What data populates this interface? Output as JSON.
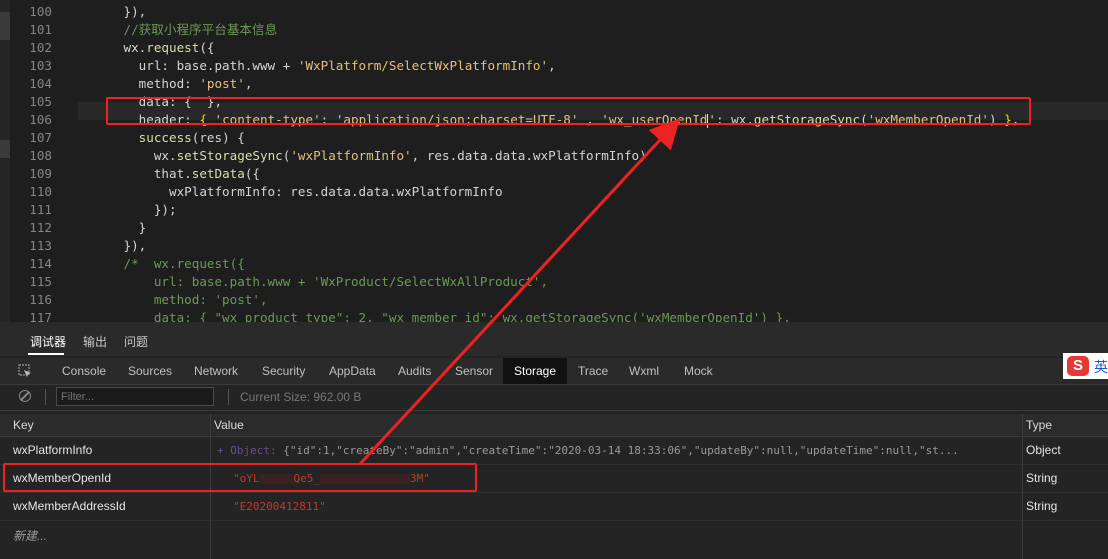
{
  "editor": {
    "lines": [
      {
        "n": "100",
        "parts": [
          [
            "k",
            "      }),"
          ]
        ]
      },
      {
        "n": "101",
        "parts": [
          [
            "c",
            "      //获取小程序平台基本信息"
          ]
        ]
      },
      {
        "n": "102",
        "parts": [
          [
            "k",
            "      wx."
          ],
          [
            "f",
            "request"
          ],
          [
            "k",
            "({"
          ]
        ]
      },
      {
        "n": "103",
        "parts": [
          [
            "k",
            "        url: base.path.www + "
          ],
          [
            "s",
            "'WxPlatform/SelectWxPlatformInfo'"
          ],
          [
            "k",
            ","
          ]
        ]
      },
      {
        "n": "104",
        "parts": [
          [
            "k",
            "        method: "
          ],
          [
            "s",
            "'post'"
          ],
          [
            "k",
            ","
          ]
        ]
      },
      {
        "n": "105",
        "parts": [
          [
            "k",
            "        data: {  },"
          ]
        ]
      },
      {
        "n": "106",
        "parts": [
          [
            "k",
            "        header: "
          ],
          [
            "y",
            "{"
          ],
          [
            "k",
            " "
          ],
          [
            "s",
            "'content-type'"
          ],
          [
            "k",
            ": "
          ],
          [
            "s",
            "'application/json;charset=UTF-8'"
          ],
          [
            "k",
            " , "
          ],
          [
            "s",
            "'wx_userOpenId"
          ],
          [
            "cursor",
            ""
          ],
          [
            "s",
            "'"
          ],
          [
            "k",
            ": wx."
          ],
          [
            "f",
            "getStorageSync"
          ],
          [
            "k",
            "("
          ],
          [
            "s",
            "'wxMemberOpenId'"
          ],
          [
            "k",
            ") "
          ],
          [
            "y",
            "}"
          ],
          [
            "k",
            ","
          ]
        ]
      },
      {
        "n": "107",
        "parts": [
          [
            "k",
            "        "
          ],
          [
            "f",
            "success"
          ],
          [
            "k",
            "(res) {"
          ]
        ]
      },
      {
        "n": "108",
        "parts": [
          [
            "k",
            "          wx."
          ],
          [
            "f",
            "setStorageSync"
          ],
          [
            "k",
            "("
          ],
          [
            "s",
            "'wxPlatformInfo'"
          ],
          [
            "k",
            ", res.data.data.wxPlatformInfo)"
          ]
        ]
      },
      {
        "n": "109",
        "parts": [
          [
            "k",
            "          that."
          ],
          [
            "f",
            "setData"
          ],
          [
            "k",
            "({"
          ]
        ]
      },
      {
        "n": "110",
        "parts": [
          [
            "k",
            "            wxPlatformInfo: res.data.data.wxPlatformInfo"
          ]
        ]
      },
      {
        "n": "111",
        "parts": [
          [
            "k",
            "          });"
          ]
        ]
      },
      {
        "n": "112",
        "parts": [
          [
            "k",
            "        }"
          ]
        ]
      },
      {
        "n": "113",
        "parts": [
          [
            "k",
            "      }),"
          ]
        ]
      },
      {
        "n": "114",
        "parts": [
          [
            "c",
            "      /*  wx.request({"
          ]
        ]
      },
      {
        "n": "115",
        "parts": [
          [
            "c",
            "          url: base.path.www + 'WxProduct/SelectWxAllProduct',"
          ]
        ]
      },
      {
        "n": "116",
        "parts": [
          [
            "c",
            "          method: 'post',"
          ]
        ]
      },
      {
        "n": "117",
        "parts": [
          [
            "c",
            "          data: { \"wx_product_type\": 2, \"wx_member_id\": wx.getStorageSync('wxMemberOpenId') },"
          ]
        ]
      }
    ]
  },
  "devtools": {
    "top_tabs": [
      "调试器",
      "输出",
      "问题"
    ],
    "panel_tabs": [
      "Console",
      "Sources",
      "Network",
      "Security",
      "AppData",
      "Audits",
      "Sensor",
      "Storage",
      "Trace",
      "Wxml",
      "Mock"
    ],
    "active_panel": "Storage",
    "filter_placeholder": "Filter...",
    "current_size": "Current Size: 962.00 B",
    "ime_label": "英",
    "ime_logo": "S",
    "table": {
      "headers": {
        "key": "Key",
        "value": "Value",
        "type": "Type"
      },
      "rows": [
        {
          "key": "wxPlatformInfo",
          "value_prefix": "+ Object:",
          "value": " {\"id\":1,\"createBy\":\"admin\",\"createTime\":\"2020-03-14 18:33:06\",\"updateBy\":null,\"updateTime\":null,\"st...",
          "type": "Object"
        },
        {
          "key": "wxMemberOpenId",
          "value_a": "\"oYL",
          "value_b": "Qe5_",
          "value_c": "3M\"",
          "type": "String"
        },
        {
          "key": "wxMemberAddressId",
          "value": "\"E20200412811\"",
          "type": "String"
        }
      ],
      "new_row": "新建..."
    }
  },
  "colors": {
    "annotation": "#ee2222",
    "string": "#e5c07b",
    "comment": "#6a9955"
  }
}
